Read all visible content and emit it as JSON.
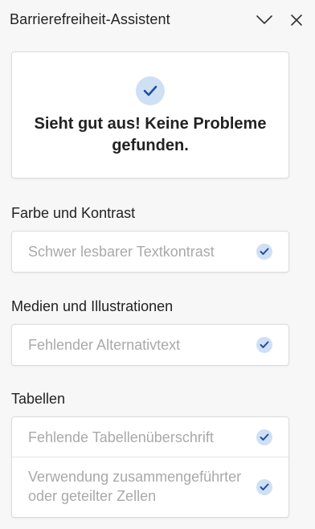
{
  "header": {
    "title": "Barrierefreiheit-Assistent",
    "collapse_icon": "chevron-down-icon",
    "close_icon": "close-icon"
  },
  "summary": {
    "icon": "check-circle-icon",
    "message": "Sieht gut aus! Keine Probleme gefunden."
  },
  "sections": [
    {
      "heading": "Farbe und Kontrast",
      "items": [
        {
          "label": "Schwer lesbarer Textkontrast",
          "status_icon": "check-icon"
        }
      ]
    },
    {
      "heading": "Medien und Illustrationen",
      "items": [
        {
          "label": "Fehlender Alternativtext",
          "status_icon": "check-icon"
        }
      ]
    },
    {
      "heading": "Tabellen",
      "items": [
        {
          "label": "Fehlende Tabellenüberschrift",
          "status_icon": "check-icon"
        },
        {
          "label": "Verwendung zusammengeführter oder geteilter Zellen",
          "status_icon": "check-icon"
        }
      ]
    }
  ],
  "colors": {
    "accent": "#1f4fa0",
    "check_bg": "#cfe0f5",
    "muted_text": "#a9a9a9",
    "pane_bg": "#f7f7f7"
  }
}
